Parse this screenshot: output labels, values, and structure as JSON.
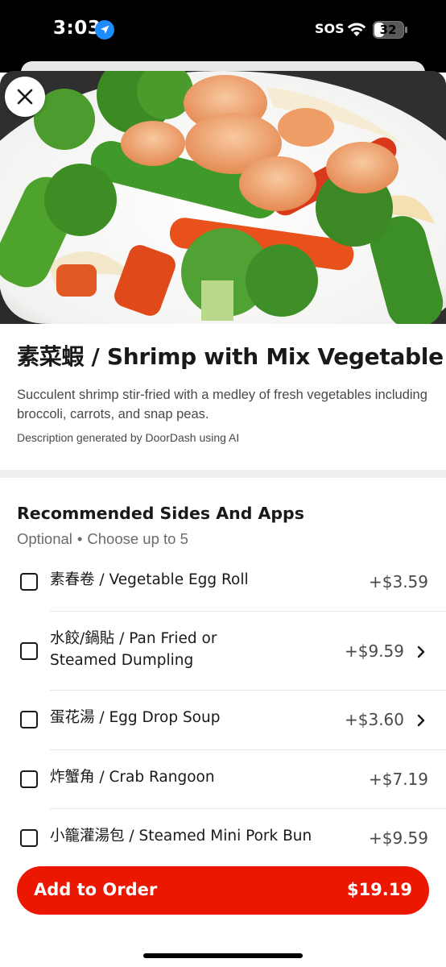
{
  "status_bar": {
    "time": "3:03",
    "sos": "SOS",
    "battery": "32",
    "icons": [
      "location-arrow-icon",
      "wifi-icon",
      "battery-icon"
    ]
  },
  "item": {
    "title": "素菜蝦 / Shrimp with Mix Vegetable",
    "description": "Succulent shrimp stir-fried with a medley of fresh vegetables including broccoli, carrots, and snap peas.",
    "ai_note": "Description generated by DoorDash using AI",
    "image_icon": "shrimp-vegetable-photo"
  },
  "section": {
    "title": "Recommended Sides And Apps",
    "optional": "Optional",
    "separator": "•",
    "choose": "Choose up to 5"
  },
  "options": [
    {
      "label": "素春卷 / Vegetable Egg Roll",
      "price": "+$3.59",
      "has_chevron": false
    },
    {
      "label": "水餃/鍋貼 / Pan Fried or Steamed Dumpling",
      "price": "+$9.59",
      "has_chevron": true
    },
    {
      "label": "蛋花湯 / Egg Drop Soup",
      "price": "+$3.60",
      "has_chevron": true
    },
    {
      "label": "炸蟹角 / Crab Rangoon",
      "price": "+$7.19",
      "has_chevron": false
    },
    {
      "label": "小籠灌湯包 / Steamed Mini Pork Bun",
      "price": "+$9.59",
      "has_chevron": false
    }
  ],
  "order_button": {
    "label": "Add to Order",
    "price": "$19.19"
  },
  "colors": {
    "accent": "#eb1700",
    "text_primary": "#191919",
    "text_secondary": "#494949",
    "divider": "#eeeeee"
  }
}
